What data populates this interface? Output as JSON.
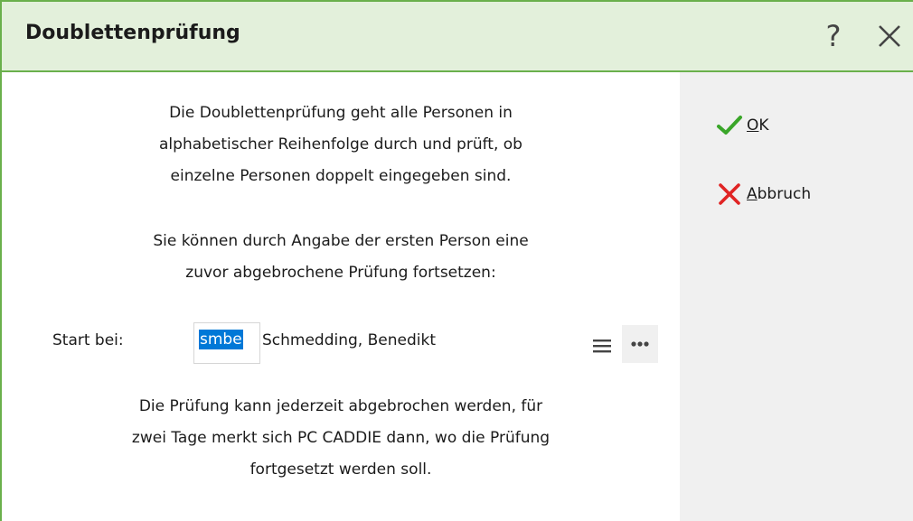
{
  "dialog": {
    "title": "Doublettenprüfung",
    "help_label": "?"
  },
  "content": {
    "intro_lines": [
      "Die Doublettenprüfung geht alle Personen in",
      "alphabetischer Reihenfolge durch und prüft, ob",
      "einzelne Personen doppelt eingegeben sind."
    ],
    "resume_lines": [
      "Sie können durch Angabe der ersten Person eine",
      "zuvor abgebrochene Prüfung fortsetzen:"
    ],
    "start_label": "Start bei:",
    "person_code": "smbe",
    "person_name": "Schmedding, Benedikt",
    "note_lines": [
      "Die Prüfung kann jederzeit abgebrochen werden, für",
      "zwei Tage merkt sich PC CADDIE dann, wo die Prüfung",
      "fortgesetzt werden soll."
    ]
  },
  "actions": {
    "ok": {
      "mnemonic": "O",
      "rest": "K",
      "icon": "checkmark-icon"
    },
    "cancel": {
      "mnemonic": "A",
      "rest": "bbruch",
      "icon": "cross-icon"
    }
  },
  "colors": {
    "accent_green": "#6ab04c",
    "titlebar_bg": "#e3f0db",
    "check_green": "#3aa629",
    "cross_red": "#e02424",
    "selection_blue": "#0078d7"
  }
}
